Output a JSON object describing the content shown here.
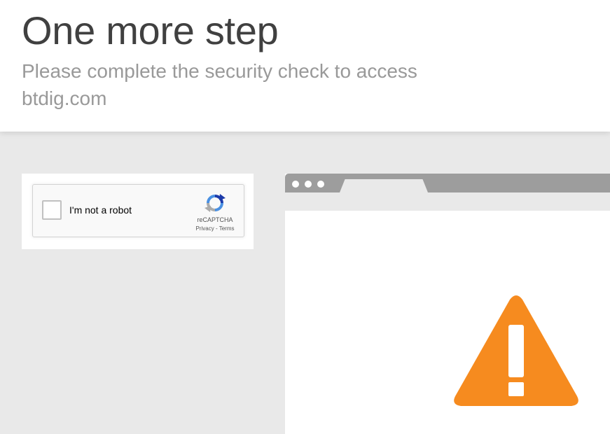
{
  "header": {
    "title": "One more step",
    "subtitle": "Please complete the security check to access btdig.com"
  },
  "captcha": {
    "label": "I'm not a robot",
    "brand": "reCAPTCHA",
    "privacy": "Privacy",
    "separator": " - ",
    "terms": "Terms",
    "checked": false
  },
  "illustration": {
    "warning_icon": "warning-icon",
    "warning_color": "#f68b1f"
  },
  "colors": {
    "page_background": "#e9e9e9",
    "title_text": "#404040",
    "subtitle_text": "#999999",
    "browser_bar": "#9d9d9d"
  }
}
